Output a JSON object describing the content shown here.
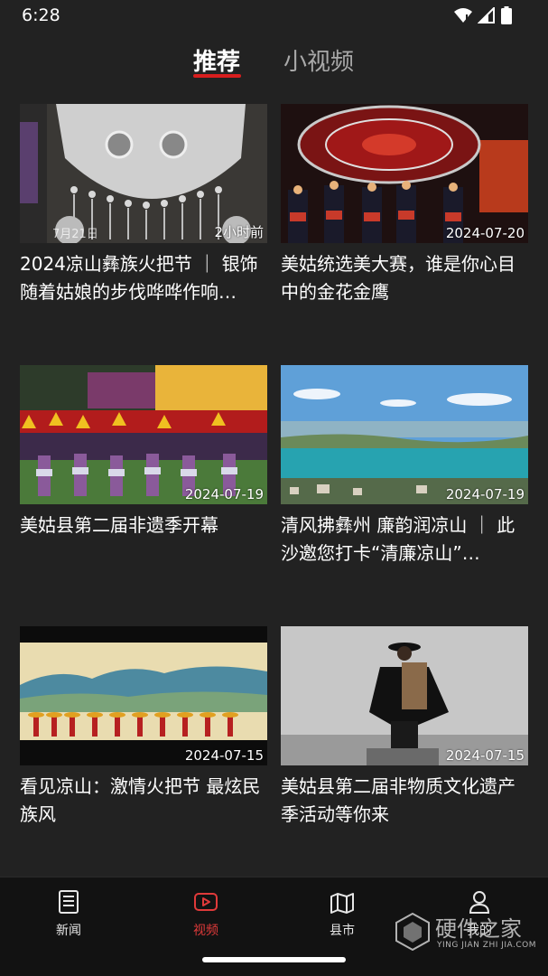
{
  "status_bar": {
    "time": "6:28"
  },
  "tabs": {
    "recommend": "推荐",
    "short_video": "小视频"
  },
  "cards": [
    {
      "title": "2024凉山彝族火把节 ｜ 银饰随着姑娘的步伐哗哗作响…",
      "date": "2小时前",
      "left_label": "7月21日"
    },
    {
      "title": "美姑统选美大赛，谁是你心目中的金花金鹰",
      "date": "2024-07-20"
    },
    {
      "title": "美姑县第二届非遗季开幕",
      "date": "2024-07-19"
    },
    {
      "title": "清风拂彝州 廉韵润凉山 ｜ 此沙邀您打卡“清廉凉山”…",
      "date": "2024-07-19"
    },
    {
      "title": "看见凉山：激情火把节 最炫民族风",
      "date": "2024-07-15"
    },
    {
      "title": "美姑县第二届非物质文化遗产季活动等你来",
      "date": "2024-07-15"
    }
  ],
  "bottom_nav": {
    "news": "新闻",
    "video": "视频",
    "county": "县市",
    "mine": "我的"
  },
  "watermark": {
    "text": "硬件之家",
    "sub": "YING JIAN ZHI JIA.COM"
  },
  "colors": {
    "accent": "#d81e1e",
    "background": "#222222",
    "nav_background": "#121212"
  }
}
